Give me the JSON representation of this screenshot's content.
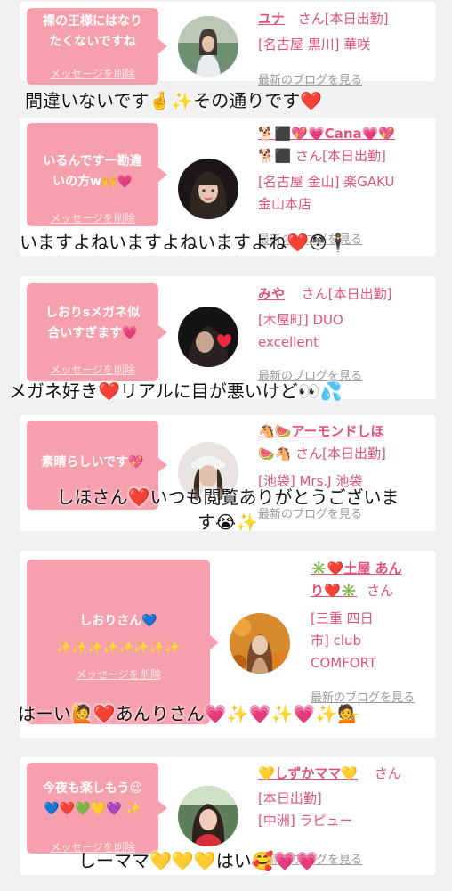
{
  "delete_label": "メッセージを削除",
  "blog_label": "最新のブログを見る",
  "colors": {
    "bubble": "#f7a0ad",
    "accent": "#e0527a",
    "background": "#f1f1f3"
  },
  "cards": [
    {
      "message": "裸の王様にはなり\nたくないですね",
      "name": "ユナ",
      "suffix": "さん[本日出勤]",
      "shop": "[名古屋 黒川] 華咲",
      "reply": "間違いないです🤞✨その通りです❤️"
    },
    {
      "message": "いるんです一勘違\nいの方w🙌💗",
      "name": "🐕⬛💖💗Cana💗💖",
      "suffix": "🐕⬛ さん[本日出勤]",
      "shop": "[名古屋 金山] 楽GAKU\n金山本店",
      "reply": "いますよねいますよねいますよね❤️😳🕴"
    },
    {
      "message": "しおりsメガネ似\n合いすぎます💗",
      "name": "みや",
      "suffix": "さん[本日出勤]",
      "shop": "[木屋町] DUO\nexcellent",
      "reply": "メガネ好き❤️リアルに目が悪いけど👀💦"
    },
    {
      "message": "素晴らしいです💖",
      "name": "🐴🍉アーモンドしほ",
      "suffix": "🍉🐴 さん[本日出勤]",
      "shop": "[池袋] Mrs.J 池袋",
      "reply": "しほさん❤️いつも閲覧ありがとうございま\nす😭✨"
    },
    {
      "message": "しおりさん💙\n✨✨✨✨✨✨✨✨",
      "name": "✳️❤️土屋 あん\nり❤️✳️",
      "suffix": "さん",
      "shop": "[三重 四日\n市] club\nCOMFORT",
      "reply": "はーい🙋❤️あんりさん💗✨💗✨💗✨💁"
    },
    {
      "message": "今夜も楽しもう😉\n💙❤️💚💛💜 ✨",
      "name": "💛しずかママ💛",
      "suffix": "さん",
      "shop": "[本日出勤]\n[中洲] ラピュー",
      "reply": "しーママ💛💛💛はい🥰💗💗"
    }
  ]
}
